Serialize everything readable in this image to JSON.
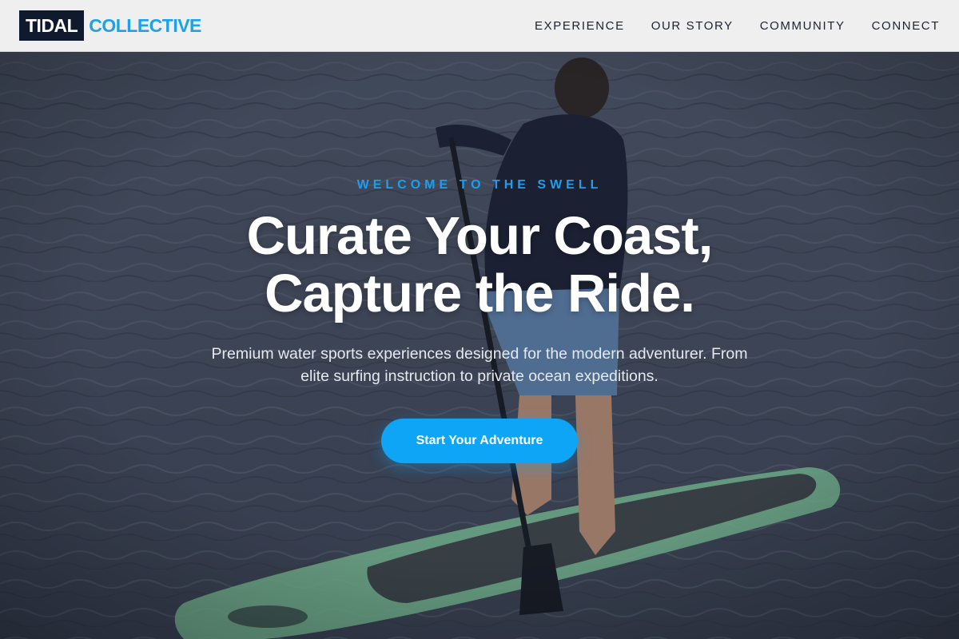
{
  "brand": {
    "box_text": "TIDAL",
    "word_text": "COLLECTIVE",
    "box_color": "#101a2e",
    "accent_color": "#1aa3ea"
  },
  "nav": {
    "items": [
      {
        "label": "EXPERIENCE"
      },
      {
        "label": "OUR STORY"
      },
      {
        "label": "COMMUNITY"
      },
      {
        "label": "CONNECT"
      }
    ]
  },
  "hero": {
    "eyebrow": "WELCOME TO THE SWELL",
    "headline_line1": "Curate Your Coast,",
    "headline_line2": "Capture the Ride.",
    "subtext": "Premium water sports experiences designed for the modern adventurer. From elite surfing instruction to private ocean expeditions.",
    "cta_label": "Start Your Adventure",
    "cta_color": "#0ea5f6",
    "background_image": "paddleboarder-on-ocean-photo"
  }
}
